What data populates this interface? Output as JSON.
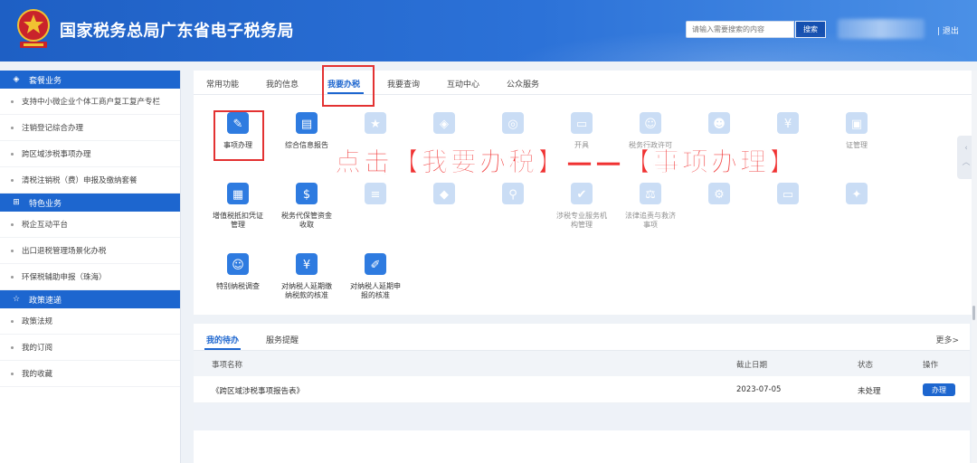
{
  "header": {
    "title": "国家税务总局广东省电子税务局",
    "search_placeholder": "请输入需要搜索的内容",
    "search_button": "搜索",
    "logout": "| 退出"
  },
  "sidebar": {
    "sections": [
      {
        "title": "套餐业务",
        "icon": "cube-icon",
        "items": [
          "支持中小微企业个体工商户复工复产专栏",
          "注销登记综合办理",
          "跨区域涉税事项办理",
          "清税注销税（费）申报及缴纳套餐"
        ]
      },
      {
        "title": "特色业务",
        "icon": "grid-icon",
        "items": [
          "税企互动平台",
          "出口退税管理场景化办税",
          "环保税辅助申报（珠海）"
        ]
      },
      {
        "title": "政策速递",
        "icon": "star-icon",
        "items": [
          "政策法规",
          "我的订阅",
          "我的收藏"
        ]
      }
    ]
  },
  "tabs": [
    "常用功能",
    "我的信息",
    "我要办税",
    "我要查询",
    "互动中心",
    "公众服务"
  ],
  "tiles": [
    {
      "label": "事项办理",
      "icon": "pencil-icon",
      "color": "#2e7be0"
    },
    {
      "label": "综合信息报告",
      "icon": "clipboard-icon",
      "color": "#2e7be0"
    },
    {
      "label": "",
      "icon": "document-star-icon",
      "color": "#9fc3ee"
    },
    {
      "label": "",
      "icon": "cube-icon",
      "color": "#9fc3ee"
    },
    {
      "label": "",
      "icon": "coins-icon",
      "color": "#9fc3ee"
    },
    {
      "label": "开具",
      "icon": "ticket-icon",
      "color": "#9fc3ee"
    },
    {
      "label": "税务行政许可",
      "icon": "person-card-icon",
      "color": "#9fc3ee"
    },
    {
      "label": "",
      "icon": "person-icon",
      "color": "#9fc3ee"
    },
    {
      "label": "",
      "icon": "refund-icon",
      "color": "#9fc3ee"
    },
    {
      "label": "证管理",
      "icon": "certificate-icon",
      "color": "#9fc3ee"
    },
    {
      "label": "增值税抵扣凭证管理",
      "icon": "invoice-icon",
      "color": "#2e7be0"
    },
    {
      "label": "税务代保管资金收取",
      "icon": "money-bag-icon",
      "color": "#2e7be0"
    },
    {
      "label": "",
      "icon": "form-icon",
      "color": "#9fc3ee"
    },
    {
      "label": "",
      "icon": "shield-icon",
      "color": "#9fc3ee"
    },
    {
      "label": "",
      "icon": "person-search-icon",
      "color": "#9fc3ee"
    },
    {
      "label": "涉税专业服务机构管理",
      "icon": "person-check-icon",
      "color": "#9fc3ee"
    },
    {
      "label": "法律追责与救济事项",
      "icon": "gavel-icon",
      "color": "#9fc3ee"
    },
    {
      "label": "",
      "icon": "doc-gear-icon",
      "color": "#9fc3ee"
    },
    {
      "label": "",
      "icon": "ticket-icon",
      "color": "#9fc3ee"
    },
    {
      "label": "",
      "icon": "badge-icon",
      "color": "#9fc3ee"
    },
    {
      "label": "特别纳税调查",
      "icon": "person-card-icon",
      "color": "#2e7be0"
    },
    {
      "label": "对纳税人延期缴纳税款的核准",
      "icon": "calendar-money-icon",
      "color": "#2e7be0"
    },
    {
      "label": "对纳税人延期申报的核准",
      "icon": "edit-card-icon",
      "color": "#2e7be0"
    }
  ],
  "overlay_text": "点击【我要办税】——【事项办理】",
  "bottom": {
    "tabs": [
      "我的待办",
      "服务提醒"
    ],
    "more": "更多>",
    "columns": [
      "事项名称",
      "截止日期",
      "状态",
      "操作"
    ],
    "rows": [
      {
        "name": "《跨区域涉税事项报告表》",
        "deadline": "2023-07-05",
        "status": "未处理",
        "action": "办理"
      }
    ]
  },
  "colors": {
    "brand": "#1d66cf",
    "header": "#2c72d8",
    "highlight": "#e33232"
  }
}
